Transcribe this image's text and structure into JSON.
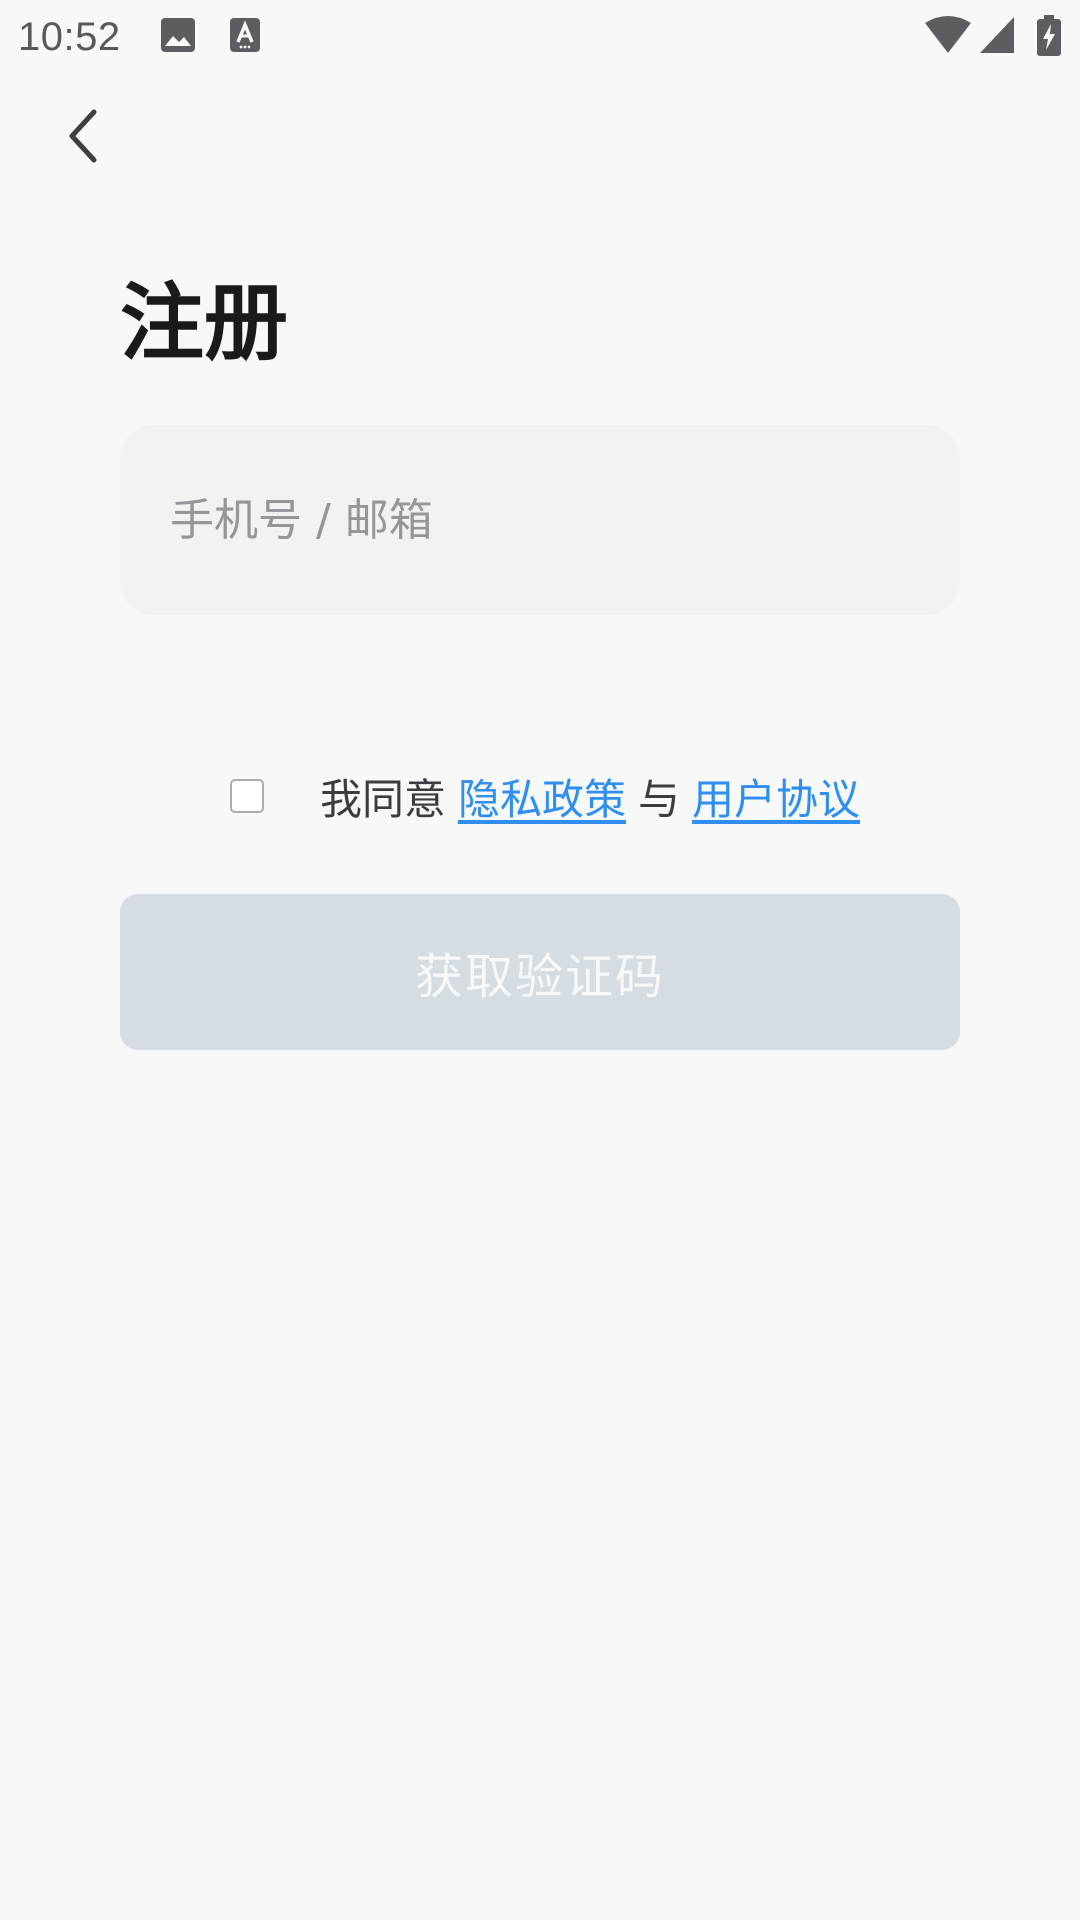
{
  "status_bar": {
    "time": "10:52",
    "icons": [
      "gallery-icon",
      "text-a-icon",
      "wifi-icon",
      "cell-signal-icon",
      "battery-charging-icon"
    ]
  },
  "header": {
    "back_icon": "chevron-left-icon"
  },
  "page": {
    "title": "注册"
  },
  "account_input": {
    "placeholder": "手机号 / 邮箱",
    "value": ""
  },
  "agreement": {
    "checked": false,
    "prefix": "我同意",
    "privacy_link": "隐私政策",
    "connector": "与",
    "terms_link": "用户协议"
  },
  "submit": {
    "label": "获取验证码",
    "enabled": false
  },
  "colors": {
    "background": "#f7f8f8",
    "input_background": "#f1f2f2",
    "link": "#2f8ef0",
    "button_disabled": "#d5dce2",
    "button_text": "#f6f8f9",
    "title": "#1a1a1a"
  }
}
